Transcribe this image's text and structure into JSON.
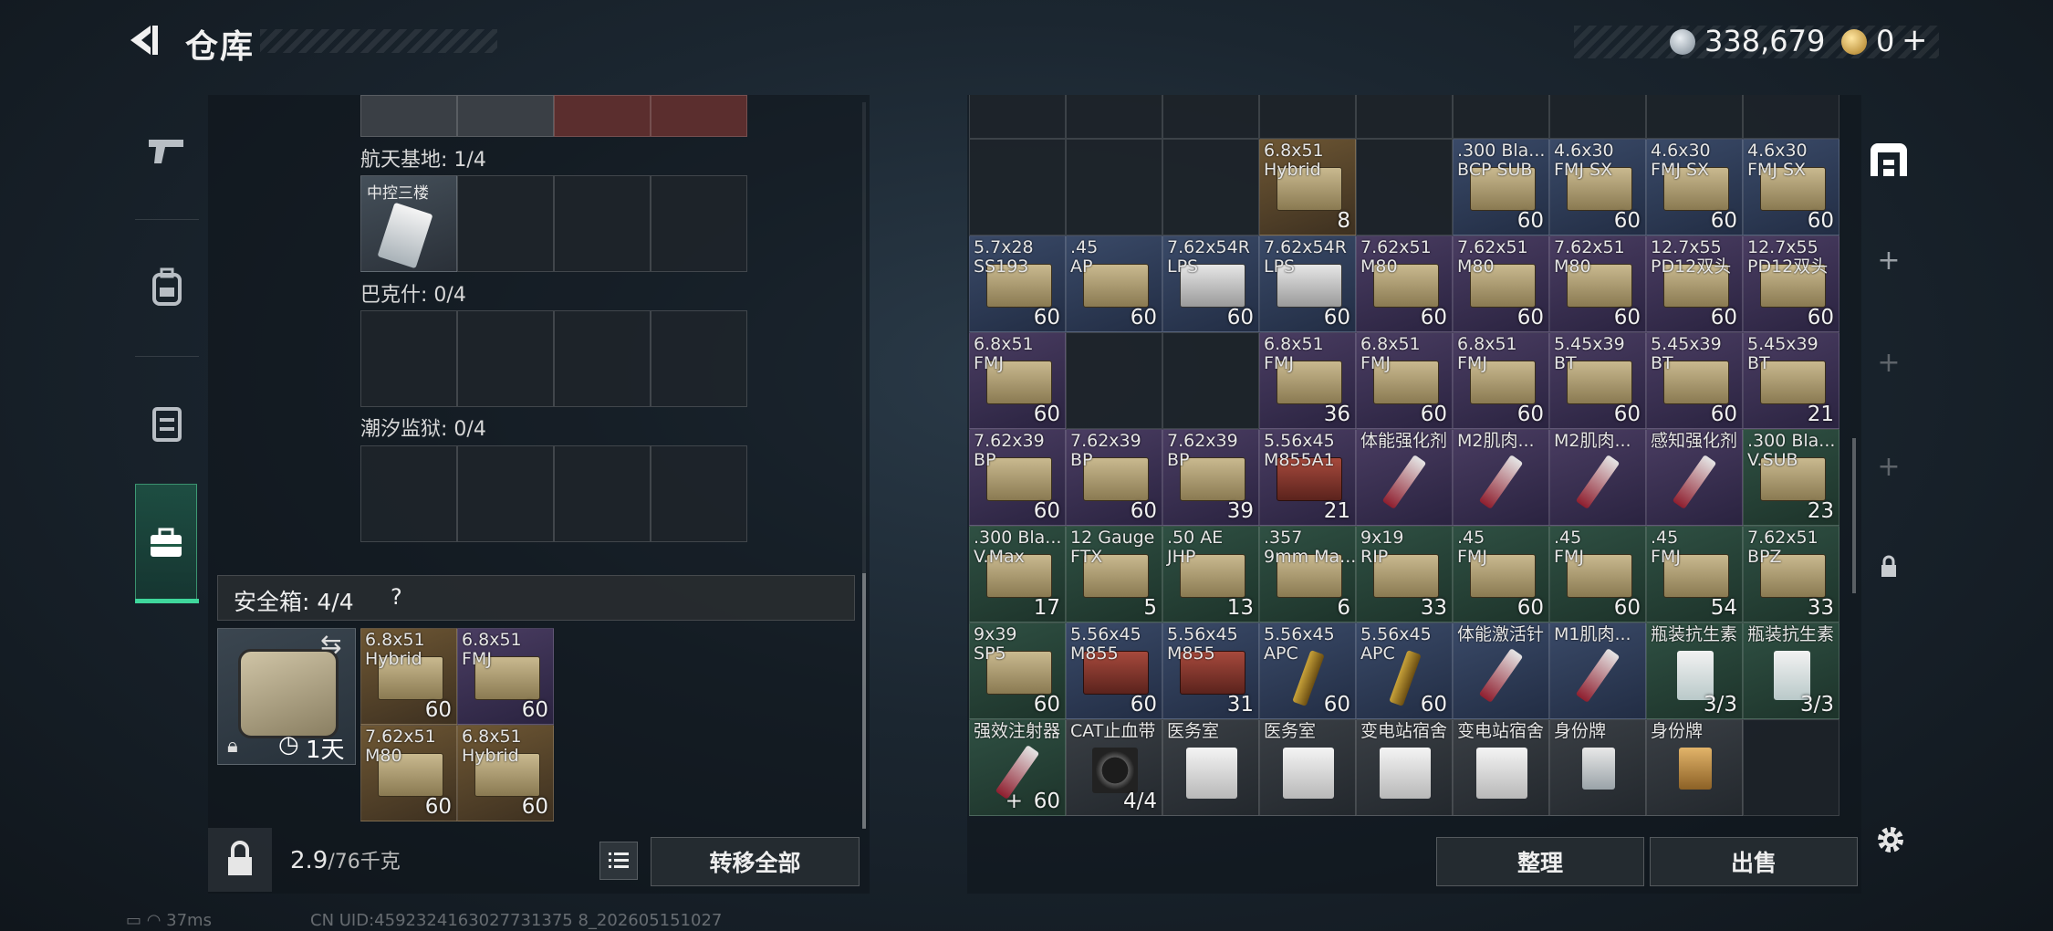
{
  "header": {
    "title": "仓库",
    "coins": "338,679",
    "gems": "0",
    "gems_plus": "+"
  },
  "left_nav": [
    {
      "icon": "pistol-icon"
    },
    {
      "icon": "backpack-icon"
    },
    {
      "icon": "vest-icon"
    },
    {
      "icon": "briefcase-icon",
      "active": true
    }
  ],
  "collections": [
    {
      "label": "航天基地: 1/4",
      "items": [
        {
          "name": "中控三楼",
          "tier": "white"
        },
        {
          "name": "",
          "tier": "empty"
        },
        {
          "name": "",
          "tier": "empty"
        },
        {
          "name": "",
          "tier": "empty"
        }
      ]
    },
    {
      "label": "巴克什: 0/4"
    },
    {
      "label": "潮汐监狱: 0/4"
    }
  ],
  "safe": {
    "title": "安全箱:  4/4",
    "help": "?",
    "duration": "1天",
    "items": [
      {
        "name": "6.8x51\nHybrid",
        "count": "60",
        "tier": "gold",
        "art": "box"
      },
      {
        "name": "6.8x51\nFMJ",
        "count": "60",
        "tier": "purple",
        "art": "box"
      },
      {
        "name": "7.62x51\nM80",
        "count": "60",
        "tier": "gold",
        "art": "box"
      },
      {
        "name": "6.8x51\nHybrid",
        "count": "60",
        "tier": "gold",
        "art": "box"
      }
    ]
  },
  "bottom_left": {
    "weight": "2.9",
    "weight_max": "/76千克",
    "transfer_all": "转移全部"
  },
  "inventory": [
    {
      "name": "",
      "count": "",
      "tier": "empty"
    },
    {
      "name": "",
      "count": "",
      "tier": "empty"
    },
    {
      "name": "",
      "count": "",
      "tier": "empty"
    },
    {
      "name": "",
      "count": "",
      "tier": "empty"
    },
    {
      "name": "",
      "count": "",
      "tier": "empty"
    },
    {
      "name": "",
      "count": "",
      "tier": "empty"
    },
    {
      "name": "",
      "count": "",
      "tier": "empty"
    },
    {
      "name": "",
      "count": "",
      "tier": "empty"
    },
    {
      "name": "",
      "count": "",
      "tier": "empty"
    },
    {
      "name": "",
      "count": "",
      "tier": "empty"
    },
    {
      "name": "",
      "count": "",
      "tier": "empty"
    },
    {
      "name": "",
      "count": "",
      "tier": "empty"
    },
    {
      "name": "6.8x51\nHybrid",
      "count": "8",
      "tier": "gold",
      "art": "box"
    },
    {
      "name": "",
      "count": "",
      "tier": "empty"
    },
    {
      "name": ".300 Bla...\nBCP SUB",
      "count": "60",
      "tier": "blue",
      "art": "box"
    },
    {
      "name": "4.6x30\nFMJ SX",
      "count": "60",
      "tier": "blue",
      "art": "box"
    },
    {
      "name": "4.6x30\nFMJ SX",
      "count": "60",
      "tier": "blue",
      "art": "box"
    },
    {
      "name": "4.6x30\nFMJ SX",
      "count": "60",
      "tier": "blue",
      "art": "box"
    },
    {
      "name": "5.7x28\nSS193",
      "count": "60",
      "tier": "blue",
      "art": "box"
    },
    {
      "name": ".45\nAP",
      "count": "60",
      "tier": "blue",
      "art": "box"
    },
    {
      "name": "7.62x54R\nLPS",
      "count": "60",
      "tier": "blue",
      "art": "box-white"
    },
    {
      "name": "7.62x54R\nLPS",
      "count": "60",
      "tier": "blue",
      "art": "box-white"
    },
    {
      "name": "7.62x51\nM80",
      "count": "60",
      "tier": "purple",
      "art": "box"
    },
    {
      "name": "7.62x51\nM80",
      "count": "60",
      "tier": "purple",
      "art": "box"
    },
    {
      "name": "7.62x51\nM80",
      "count": "60",
      "tier": "purple",
      "art": "box"
    },
    {
      "name": "12.7x55\nPD12双头",
      "count": "60",
      "tier": "purple",
      "art": "box"
    },
    {
      "name": "12.7x55\nPD12双头",
      "count": "60",
      "tier": "purple",
      "art": "box"
    },
    {
      "name": "6.8x51\nFMJ",
      "count": "60",
      "tier": "purple",
      "art": "box"
    },
    {
      "name": "",
      "count": "",
      "tier": "empty"
    },
    {
      "name": "",
      "count": "",
      "tier": "empty"
    },
    {
      "name": "6.8x51\nFMJ",
      "count": "36",
      "tier": "purple",
      "art": "box"
    },
    {
      "name": "6.8x51\nFMJ",
      "count": "60",
      "tier": "purple",
      "art": "box"
    },
    {
      "name": "6.8x51\nFMJ",
      "count": "60",
      "tier": "purple",
      "art": "box"
    },
    {
      "name": "5.45x39\nBT",
      "count": "60",
      "tier": "purple",
      "art": "box"
    },
    {
      "name": "5.45x39\nBT",
      "count": "60",
      "tier": "purple",
      "art": "box"
    },
    {
      "name": "5.45x39\nBT",
      "count": "21",
      "tier": "purple",
      "art": "box"
    },
    {
      "name": "7.62x39\nBP",
      "count": "60",
      "tier": "purple",
      "art": "box"
    },
    {
      "name": "7.62x39\nBP",
      "count": "60",
      "tier": "purple",
      "art": "box"
    },
    {
      "name": "7.62x39\nBP",
      "count": "39",
      "tier": "purple",
      "art": "box"
    },
    {
      "name": "5.56x45\nM855A1",
      "count": "21",
      "tier": "purple",
      "art": "box-red"
    },
    {
      "name": "体能强化剂",
      "count": "",
      "tier": "purple",
      "art": "syringe"
    },
    {
      "name": "M2肌肉...",
      "count": "",
      "tier": "purple",
      "art": "syringe"
    },
    {
      "name": "M2肌肉...",
      "count": "",
      "tier": "purple",
      "art": "syringe"
    },
    {
      "name": "感知强化剂",
      "count": "",
      "tier": "purple",
      "art": "syringe"
    },
    {
      "name": ".300 Bla...\nV.SUB",
      "count": "23",
      "tier": "green",
      "art": "box"
    },
    {
      "name": ".300 Bla...\nV.Max",
      "count": "17",
      "tier": "green",
      "art": "box"
    },
    {
      "name": "12 Gauge\nFTX",
      "count": "5",
      "tier": "green",
      "art": "box"
    },
    {
      "name": ".50 AE\nJHP",
      "count": "13",
      "tier": "green",
      "art": "box"
    },
    {
      "name": ".357\n9mm Ma...",
      "count": "6",
      "tier": "green",
      "art": "box"
    },
    {
      "name": "9x19\nRIP",
      "count": "33",
      "tier": "green",
      "art": "box"
    },
    {
      "name": ".45\nFMJ",
      "count": "60",
      "tier": "green",
      "art": "box"
    },
    {
      "name": ".45\nFMJ",
      "count": "60",
      "tier": "green",
      "art": "box"
    },
    {
      "name": ".45\nFMJ",
      "count": "54",
      "tier": "green",
      "art": "box"
    },
    {
      "name": "7.62x51\nBPZ",
      "count": "33",
      "tier": "green",
      "art": "box"
    },
    {
      "name": "9x39\nSP5",
      "count": "60",
      "tier": "green",
      "art": "box"
    },
    {
      "name": "5.56x45\nM855",
      "count": "60",
      "tier": "blue",
      "art": "box-red"
    },
    {
      "name": "5.56x45\nM855",
      "count": "31",
      "tier": "blue",
      "art": "box-red"
    },
    {
      "name": "5.56x45\nAPC",
      "count": "60",
      "tier": "blue",
      "art": "shell"
    },
    {
      "name": "5.56x45\nAPC",
      "count": "60",
      "tier": "blue",
      "art": "shell"
    },
    {
      "name": "体能激活针",
      "count": "",
      "tier": "blue",
      "art": "syringe"
    },
    {
      "name": "M1肌肉...",
      "count": "",
      "tier": "blue",
      "art": "syringe"
    },
    {
      "name": "瓶装抗生素",
      "count": "3/3",
      "tier": "green",
      "art": "pill"
    },
    {
      "name": "瓶装抗生素",
      "count": "3/3",
      "tier": "green",
      "art": "pill"
    },
    {
      "name": "强效注射器",
      "count": "60",
      "plus": "+",
      "tier": "green",
      "art": "syringe"
    },
    {
      "name": "CAT止血带",
      "count": "4/4",
      "tier": "gray",
      "art": "tourniquet"
    },
    {
      "name": "医务室",
      "count": "",
      "tier": "gray",
      "art": "kit"
    },
    {
      "name": "医务室",
      "count": "",
      "tier": "gray",
      "art": "kit"
    },
    {
      "name": "变电站宿舍",
      "count": "",
      "tier": "gray",
      "art": "kit"
    },
    {
      "name": "变电站宿舍",
      "count": "",
      "tier": "gray",
      "art": "kit"
    },
    {
      "name": "身份牌",
      "count": "",
      "tier": "gray",
      "art": "tag"
    },
    {
      "name": "身份牌",
      "count": "",
      "tier": "gray",
      "art": "tag-gold"
    },
    {
      "name": "",
      "count": "",
      "tier": "empty"
    }
  ],
  "right_nav": [
    {
      "icon": "shelf-icon"
    },
    {
      "icon": "plus-icon",
      "glyph": "+"
    },
    {
      "icon": "plus-icon",
      "glyph": "+"
    },
    {
      "icon": "plus-icon",
      "glyph": "+"
    },
    {
      "icon": "lock-icon"
    }
  ],
  "buttons": {
    "tidy": "整理",
    "sell": "出售"
  },
  "status": {
    "ping": "37ms",
    "uid": "CN UID:4592324163027731375 8_202605151027"
  }
}
